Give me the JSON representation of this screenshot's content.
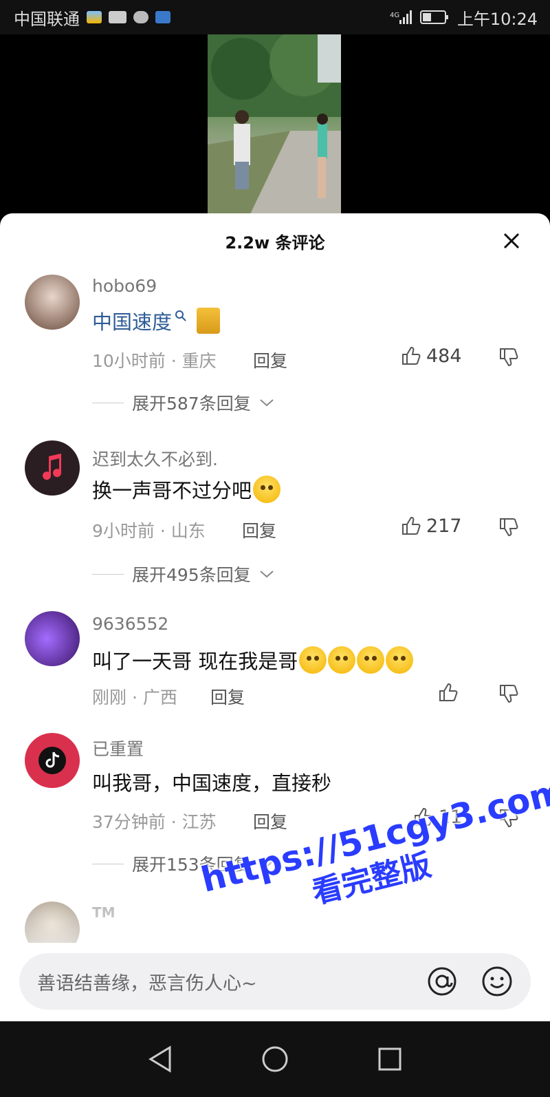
{
  "status_bar": {
    "carrier": "中国联通",
    "time": "上午10:24",
    "network": "4G"
  },
  "sheet": {
    "title": "2.2w 条评论",
    "close_icon": "close-icon"
  },
  "comments": [
    {
      "user": "hobo69",
      "text": "中国速度",
      "text_is_link": true,
      "time_location": "10小时前 · 重庆",
      "reply_label": "回复",
      "likes": "484",
      "expand_label": "展开587条回复"
    },
    {
      "user": "迟到太久不必到.",
      "text": "换一声哥不过分吧",
      "time_location": "9小时前 · 山东",
      "reply_label": "回复",
      "likes": "217",
      "expand_label": "展开495条回复"
    },
    {
      "user": "9636552",
      "text": "叫了一天哥  现在我是哥",
      "time_location": "刚刚 · 广西",
      "reply_label": "回复",
      "likes": ""
    },
    {
      "user": "已重置",
      "text": "叫我哥，中国速度，直接秒",
      "time_location": "37分钟前 · 江苏",
      "reply_label": "回复",
      "likes": "11",
      "expand_label": "展开153条回复"
    },
    {
      "user": "TM"
    }
  ],
  "input": {
    "placeholder": "善语结善缘，恶言伤人心~",
    "at_icon": "at-icon",
    "emoji_icon": "emoji-icon"
  },
  "watermark": {
    "line1": "https://51cgy3.com",
    "line2": "看完整版"
  },
  "colors": {
    "link": "#2d5b96",
    "watermark": "#2a3cff"
  }
}
